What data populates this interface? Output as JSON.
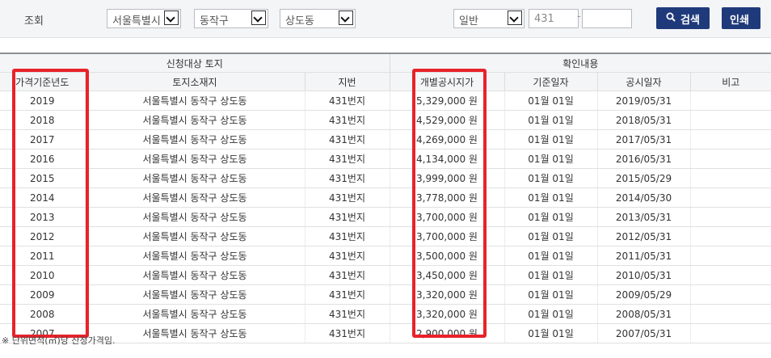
{
  "search": {
    "label": "조회",
    "city": "서울특별시",
    "district": "동작구",
    "dong": "상도동",
    "land_type": "일반",
    "main_number": "431",
    "sub_number": "",
    "dash": "-",
    "search_button": "검색",
    "print_button": "인쇄"
  },
  "table": {
    "group_headers": [
      "신청대상 토지",
      "확인내용"
    ],
    "columns": [
      "가격기준년도",
      "토지소재지",
      "지번",
      "개별공시지가",
      "기준일자",
      "공시일자",
      "비고"
    ],
    "rows": [
      {
        "year": "2019",
        "location": "서울특별시 동작구 상도동",
        "lot": "431번지",
        "price": "5,329,000 원",
        "base_date": "01월 01일",
        "notice_date": "2019/05/31",
        "remark": ""
      },
      {
        "year": "2018",
        "location": "서울특별시 동작구 상도동",
        "lot": "431번지",
        "price": "4,529,000 원",
        "base_date": "01월 01일",
        "notice_date": "2018/05/31",
        "remark": ""
      },
      {
        "year": "2017",
        "location": "서울특별시 동작구 상도동",
        "lot": "431번지",
        "price": "4,269,000 원",
        "base_date": "01월 01일",
        "notice_date": "2017/05/31",
        "remark": ""
      },
      {
        "year": "2016",
        "location": "서울특별시 동작구 상도동",
        "lot": "431번지",
        "price": "4,134,000 원",
        "base_date": "01월 01일",
        "notice_date": "2016/05/31",
        "remark": ""
      },
      {
        "year": "2015",
        "location": "서울특별시 동작구 상도동",
        "lot": "431번지",
        "price": "3,999,000 원",
        "base_date": "01월 01일",
        "notice_date": "2015/05/29",
        "remark": ""
      },
      {
        "year": "2014",
        "location": "서울특별시 동작구 상도동",
        "lot": "431번지",
        "price": "3,778,000 원",
        "base_date": "01월 01일",
        "notice_date": "2014/05/30",
        "remark": ""
      },
      {
        "year": "2013",
        "location": "서울특별시 동작구 상도동",
        "lot": "431번지",
        "price": "3,700,000 원",
        "base_date": "01월 01일",
        "notice_date": "2013/05/31",
        "remark": ""
      },
      {
        "year": "2012",
        "location": "서울특별시 동작구 상도동",
        "lot": "431번지",
        "price": "3,700,000 원",
        "base_date": "01월 01일",
        "notice_date": "2012/05/31",
        "remark": ""
      },
      {
        "year": "2011",
        "location": "서울특별시 동작구 상도동",
        "lot": "431번지",
        "price": "3,500,000 원",
        "base_date": "01월 01일",
        "notice_date": "2011/05/31",
        "remark": ""
      },
      {
        "year": "2010",
        "location": "서울특별시 동작구 상도동",
        "lot": "431번지",
        "price": "3,450,000 원",
        "base_date": "01월 01일",
        "notice_date": "2010/05/31",
        "remark": ""
      },
      {
        "year": "2009",
        "location": "서울특별시 동작구 상도동",
        "lot": "431번지",
        "price": "3,320,000 원",
        "base_date": "01월 01일",
        "notice_date": "2009/05/29",
        "remark": ""
      },
      {
        "year": "2008",
        "location": "서울특별시 동작구 상도동",
        "lot": "431번지",
        "price": "3,320,000 원",
        "base_date": "01월 01일",
        "notice_date": "2008/05/31",
        "remark": ""
      },
      {
        "year": "2007",
        "location": "서울특별시 동작구 상도동",
        "lot": "431번지",
        "price": "2,900,000 원",
        "base_date": "01월 01일",
        "notice_date": "2007/05/31",
        "remark": ""
      }
    ]
  },
  "footnote": "※ 단위면적(㎡)당 산정가격임.",
  "colors": {
    "accent": "#1f3a7a",
    "highlight": "#e8222a",
    "header_bg": "#f4f5f7"
  }
}
